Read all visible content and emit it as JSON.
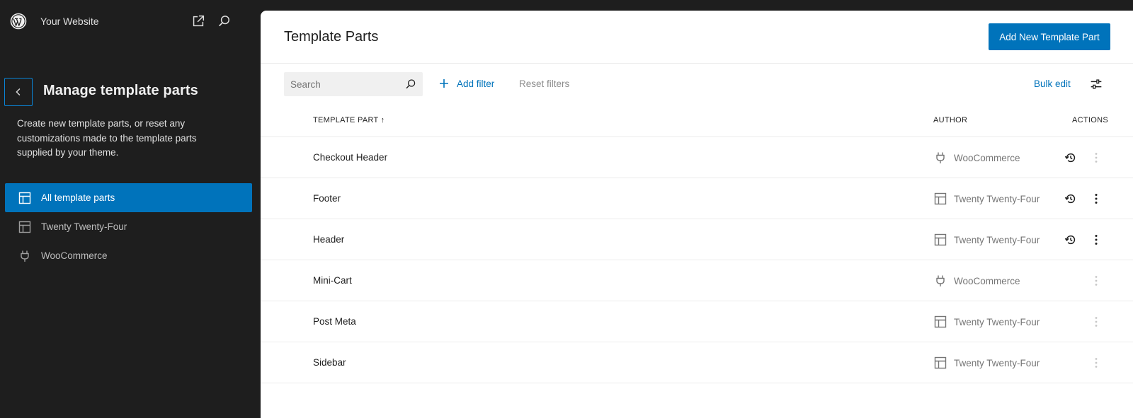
{
  "topbar": {
    "site_name": "Your Website"
  },
  "sidebar": {
    "title": "Manage template parts",
    "description": "Create new template parts, or reset any customizations made to the template parts supplied by your theme.",
    "items": [
      {
        "label": "All template parts",
        "icon": "layout-icon",
        "active": true
      },
      {
        "label": "Twenty Twenty-Four",
        "icon": "layout-icon",
        "active": false
      },
      {
        "label": "WooCommerce",
        "icon": "plugin-icon",
        "active": false
      }
    ]
  },
  "main": {
    "title": "Template Parts",
    "add_button_label": "Add New Template Part",
    "search": {
      "placeholder": "Search",
      "value": ""
    },
    "add_filter_label": "Add filter",
    "reset_filters_label": "Reset filters",
    "bulk_edit_label": "Bulk edit",
    "columns": {
      "template_part": "Template Part ↑",
      "author": "Author",
      "actions": "Actions"
    },
    "rows": [
      {
        "name": "Checkout Header",
        "author": "WooCommerce",
        "author_icon": "plugin-icon",
        "can_revert": true,
        "actions_enabled": false
      },
      {
        "name": "Footer",
        "author": "Twenty Twenty-Four",
        "author_icon": "layout-icon",
        "can_revert": true,
        "actions_enabled": true
      },
      {
        "name": "Header",
        "author": "Twenty Twenty-Four",
        "author_icon": "layout-icon",
        "can_revert": true,
        "actions_enabled": true
      },
      {
        "name": "Mini-Cart",
        "author": "WooCommerce",
        "author_icon": "plugin-icon",
        "can_revert": false,
        "actions_enabled": false
      },
      {
        "name": "Post Meta",
        "author": "Twenty Twenty-Four",
        "author_icon": "layout-icon",
        "can_revert": false,
        "actions_enabled": false
      },
      {
        "name": "Sidebar",
        "author": "Twenty Twenty-Four",
        "author_icon": "layout-icon",
        "can_revert": false,
        "actions_enabled": false
      }
    ]
  },
  "colors": {
    "accent": "#0073bb",
    "sidebar_bg": "#1e1e1e",
    "muted_text": "#757575"
  }
}
